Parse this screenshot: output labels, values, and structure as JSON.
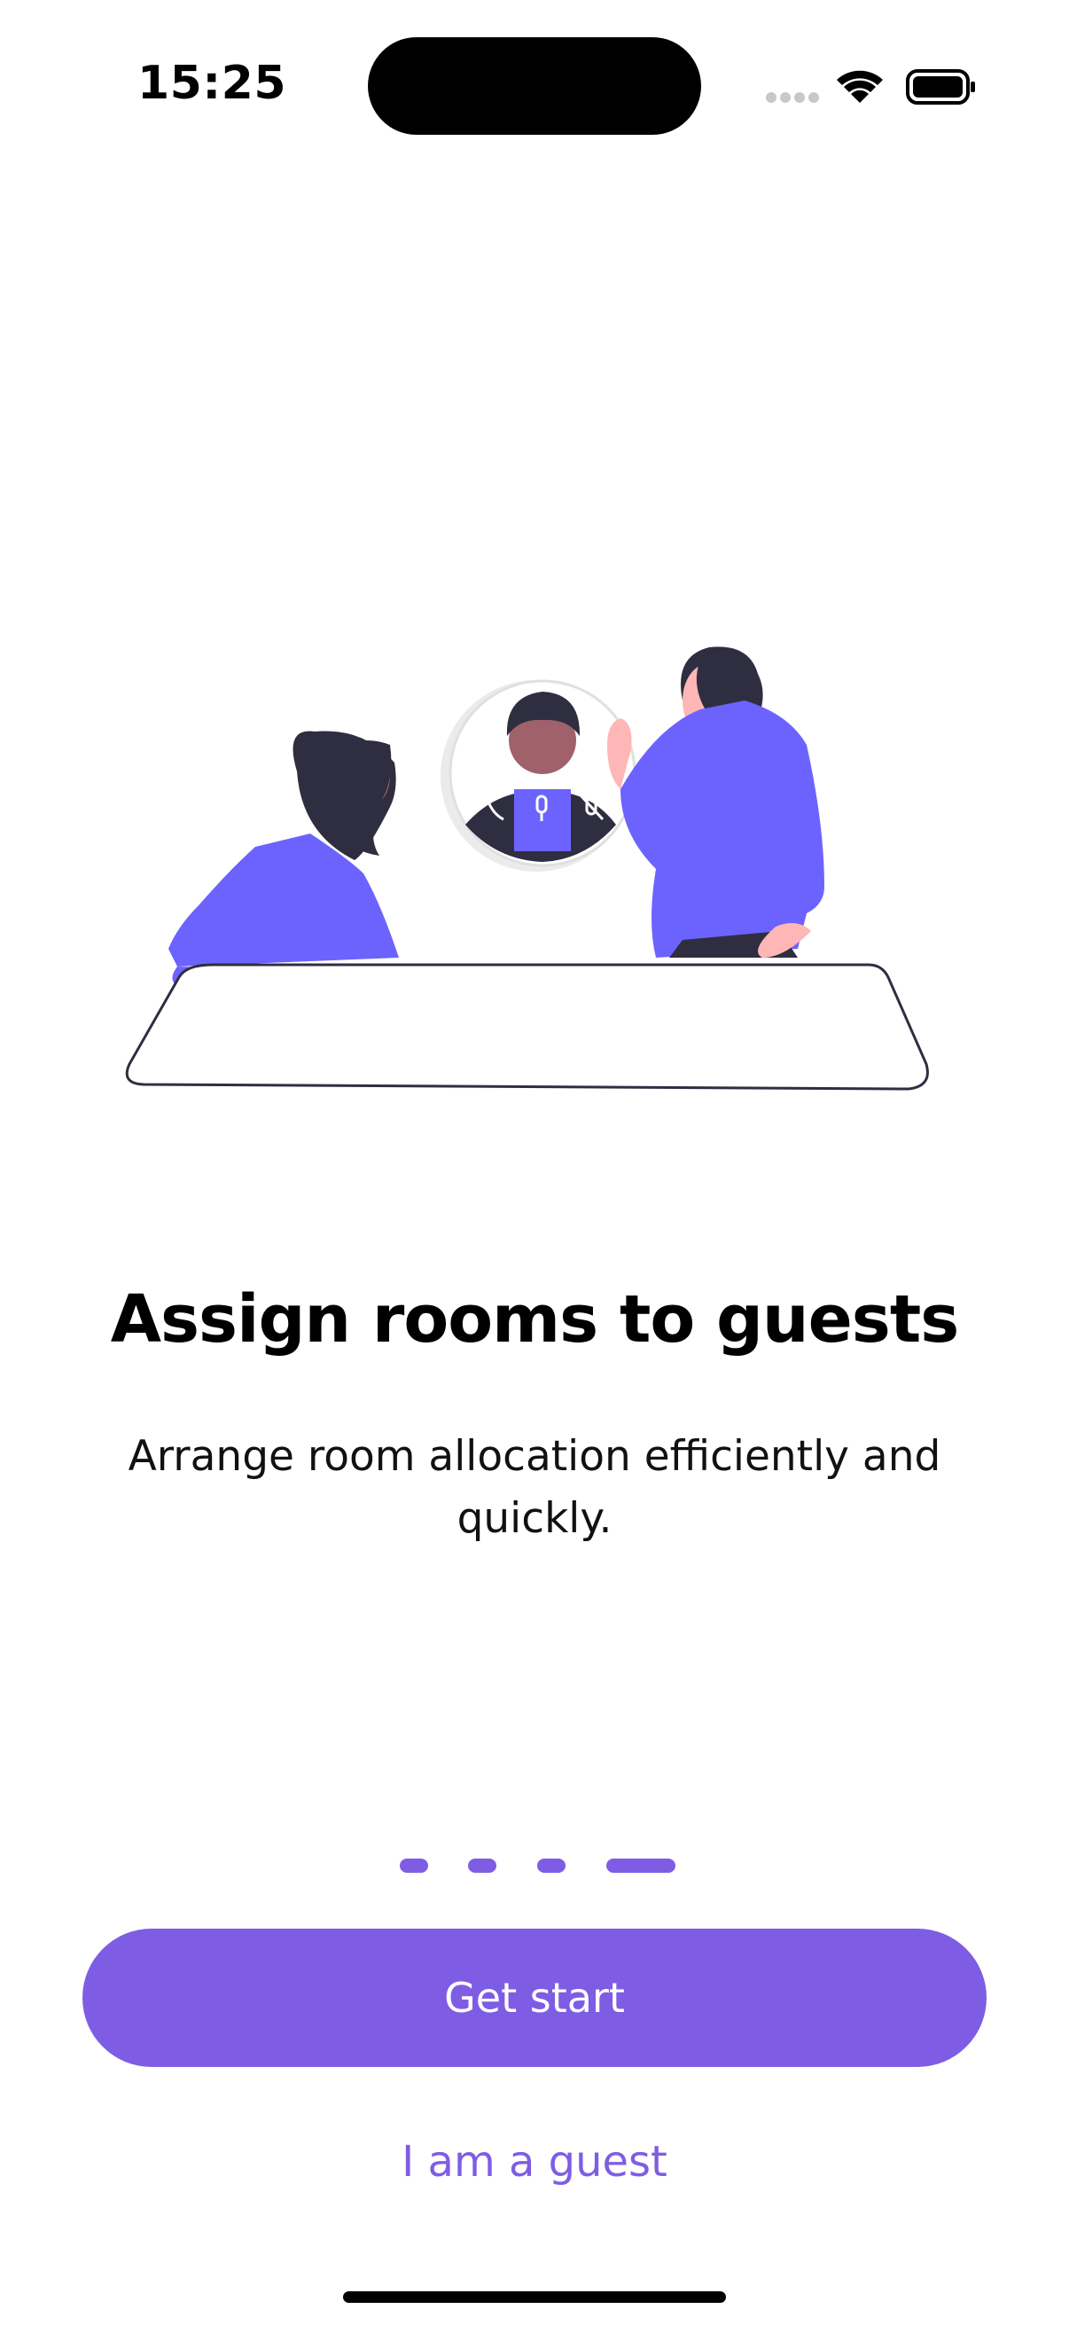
{
  "status_bar": {
    "time": "15:25",
    "icons": [
      "signal-dots-icon",
      "wifi-icon",
      "battery-icon"
    ]
  },
  "illustration": {
    "name": "meeting-illustration",
    "colors": {
      "accent": "#6c63ff",
      "skin_dark": "#a0616a",
      "skin_light": "#ffb6b6",
      "hair": "#2f2e41",
      "paper": "#f2f2f2"
    }
  },
  "onboarding": {
    "title": "Assign rooms to guests",
    "subtitle": "Arrange room allocation efficiently and quickly.",
    "page_indicator": {
      "total": 4,
      "active_index": 3
    }
  },
  "actions": {
    "primary_label": "Get start",
    "secondary_label": "I am a guest"
  },
  "theme": {
    "primary": "#7e5de4"
  }
}
